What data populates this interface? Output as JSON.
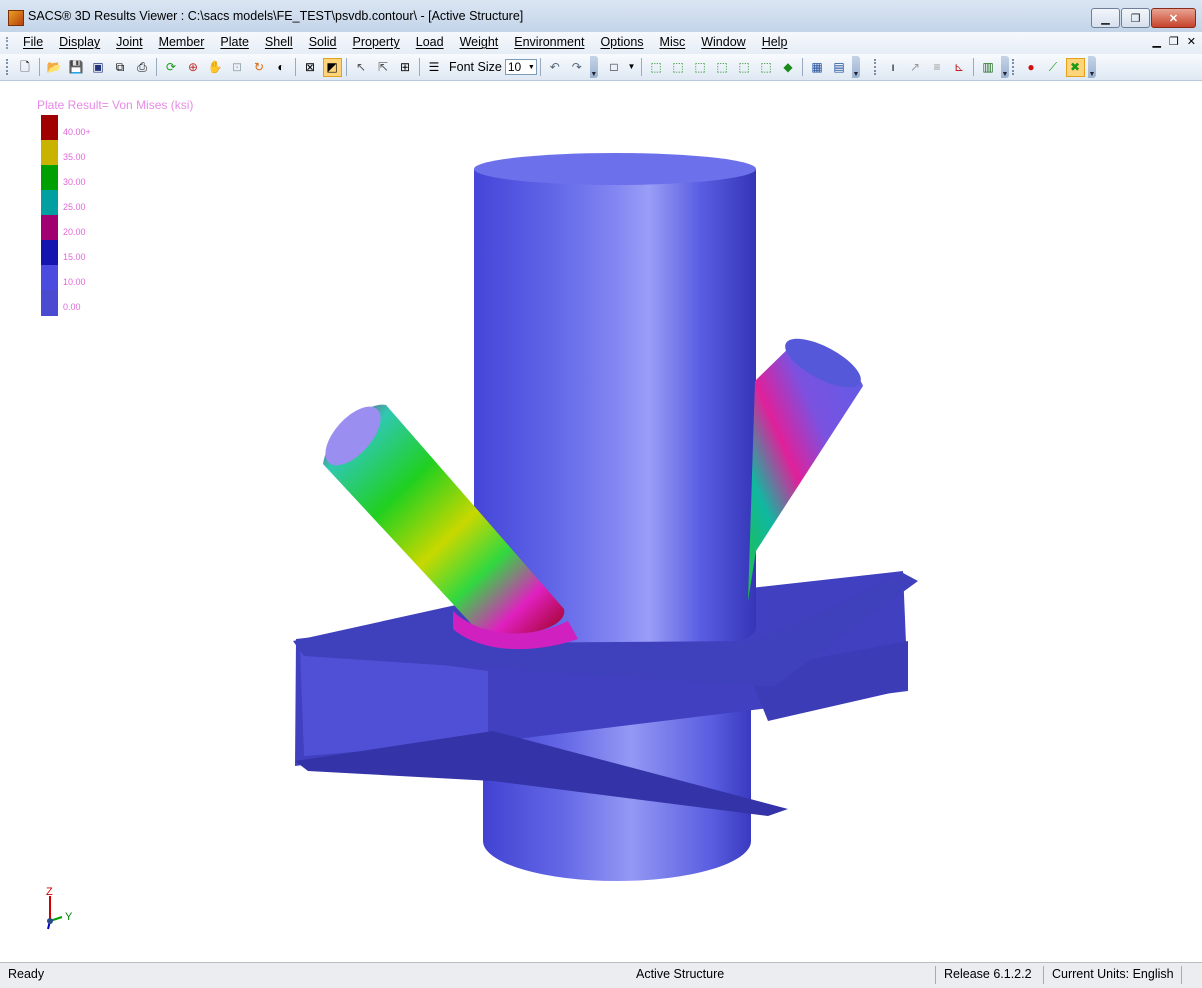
{
  "window": {
    "title": "SACS® 3D Results Viewer :  C:\\sacs models\\FE_TEST\\psvdb.contour\\ - [Active Structure]"
  },
  "menubar": {
    "items": [
      "File",
      "Display",
      "Joint",
      "Member",
      "Plate",
      "Shell",
      "Solid",
      "Property",
      "Load",
      "Weight",
      "Environment",
      "Options",
      "Misc",
      "Window",
      "Help"
    ]
  },
  "toolbar": {
    "font_size_label": "Font Size",
    "font_size_value": "10"
  },
  "legend": {
    "title": "Plate Result= Von Mises (ksi)",
    "entries": [
      {
        "label": "40.00+",
        "color": "#a00000"
      },
      {
        "label": "35.00",
        "color": "#c8b400"
      },
      {
        "label": "30.00",
        "color": "#00a000"
      },
      {
        "label": "25.00",
        "color": "#00a0a0"
      },
      {
        "label": "20.00",
        "color": "#a00070"
      },
      {
        "label": "15.00",
        "color": "#1414b0"
      },
      {
        "label": "10.00",
        "color": "#4b4be0"
      },
      {
        "label": "0.00",
        "color": "#4b4bd2"
      }
    ]
  },
  "axis_triad": {
    "z_label": "Z",
    "y_label": "Y"
  },
  "statusbar": {
    "state": "Ready",
    "active": "Active Structure",
    "release": "Release 6.1.2.2",
    "units": "Current Units: English"
  }
}
